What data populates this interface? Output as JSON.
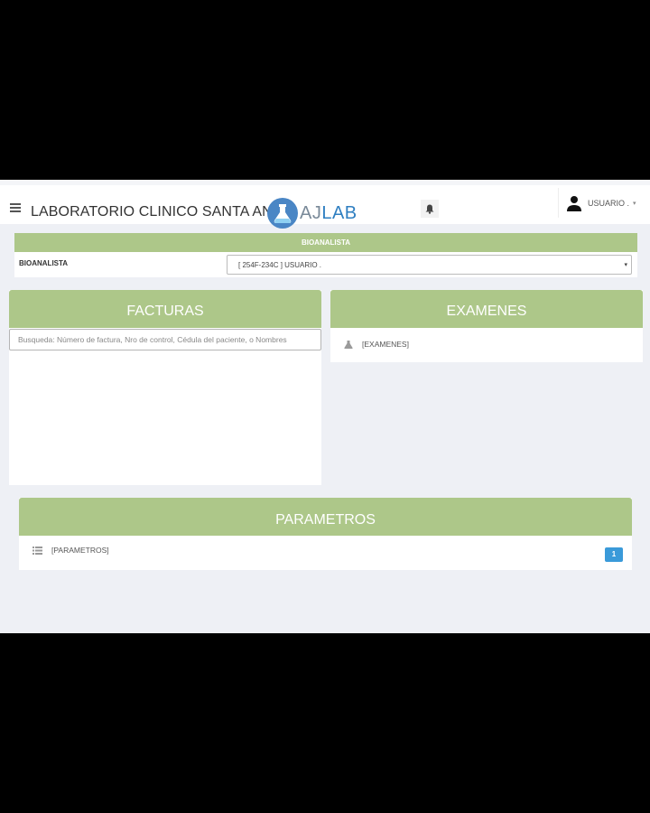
{
  "header": {
    "title": "LABORATORIO CLINICO SANTA ANA",
    "logo_aj": "AJ",
    "logo_lab": "LAB",
    "user_name": "USUARIO .",
    "caret": "▾"
  },
  "bioanalista": {
    "panel_title": "BIOANALISTA",
    "label": "BIOANALISTA",
    "selected_value": "[ 254F-234C ] USUARIO .",
    "caret": "▾"
  },
  "facturas": {
    "title": "FACTURAS",
    "search_placeholder": "Busqueda: Número de factura, Nro de control, Cédula del paciente, o Nombres"
  },
  "examenes": {
    "title": "EXAMENES",
    "item_label": "[EXAMENES]"
  },
  "parametros": {
    "title": "PARAMETROS",
    "item_label": "[PARAMETROS]",
    "badge_count": "1"
  },
  "colors": {
    "panel_header": "#adc789",
    "badge": "#3a9ad9",
    "logo_blue": "#4a86c5"
  },
  "icons": {
    "menu": "hamburger-menu-icon",
    "logo": "flask-logo-icon",
    "notifications": "bell-icon",
    "user": "user-icon",
    "examenes": "flask-icon",
    "parametros": "list-icon"
  }
}
